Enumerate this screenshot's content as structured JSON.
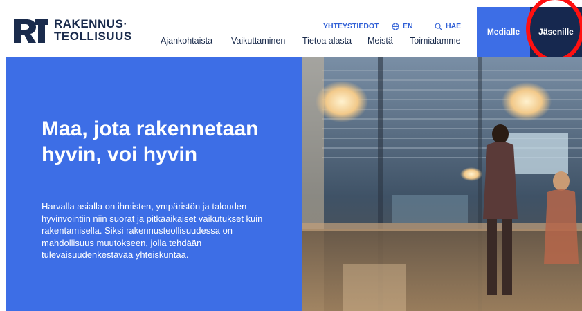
{
  "brand": {
    "name_line1": "RAKENNUS·",
    "name_line2": "TEOLLISUUS",
    "logo_icon": "rt-logo",
    "color": "#1a2b4c"
  },
  "utility": {
    "contacts": "YHTEYSTIEDOT",
    "language": "EN",
    "language_icon": "globe-icon",
    "search": "HAE",
    "search_icon": "search-icon"
  },
  "nav": {
    "items": [
      "Ajankohtaista",
      "Vaikuttaminen",
      "Tietoa alasta",
      "Meistä",
      "Toimialamme"
    ]
  },
  "actions": {
    "media": "Medialle",
    "members": "Jäsenille"
  },
  "hero": {
    "title": "Maa, jota rakennetaan hyvin, voi hyvin",
    "body": "Harvalla asialla on ihmisten, ympäristön ja talouden hyvinvointiin niin suorat ja pitkäaikaiset vaikutukset kuin rakentamisella. Siksi rakennusteollisuudessa on mahdollisuus muutokseen, jolla tehdään tulevaisuudenkestävää yhteiskuntaa.",
    "image": "street-scene-photo"
  },
  "colors": {
    "accent_blue": "#3d6ee6",
    "navy": "#16284f",
    "highlight_red": "#ff1010"
  }
}
